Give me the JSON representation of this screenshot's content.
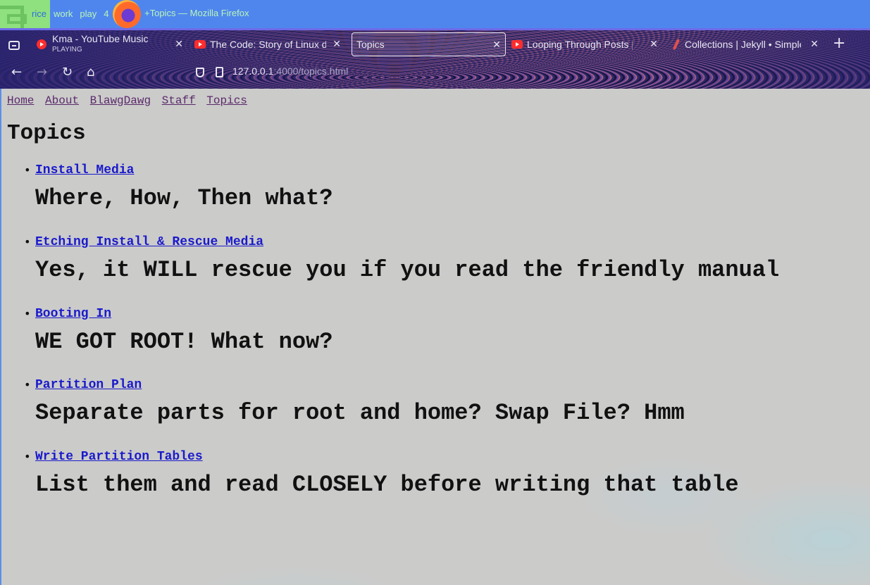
{
  "wm": {
    "workspaces": [
      "rice",
      "work",
      "play",
      "4"
    ],
    "window_title": "+Topics — Mozilla Firefox"
  },
  "tabs": [
    {
      "title": "Kma - YouTube Music",
      "subtitle": "PLAYING",
      "icon": "youtube-music-icon"
    },
    {
      "title": "The Code: Story of Linux documentary",
      "icon": "youtube-icon"
    },
    {
      "title": "Topics",
      "icon": "none",
      "active": true
    },
    {
      "title": "Looping Through Posts | Jekyll",
      "icon": "youtube-icon"
    },
    {
      "title": "Collections | Jekyll • Simple",
      "icon": "jekyll-icon"
    }
  ],
  "urlbar": {
    "host": "127.0.0.1",
    "rest": ":4000/topics.html"
  },
  "site_nav": [
    "Home",
    "About",
    "BlawgDawg",
    "Staff",
    "Topics"
  ],
  "page": {
    "title": "Topics",
    "topics": [
      {
        "link": "Install Media",
        "desc": "Where, How, Then what?"
      },
      {
        "link": "Etching Install & Rescue Media",
        "desc": "Yes, it WILL rescue you if you read the friendly manual"
      },
      {
        "link": "Booting In",
        "desc": "WE GOT ROOT! What now?"
      },
      {
        "link": "Partition Plan",
        "desc": "Separate parts for root and home? Swap File? Hmm"
      },
      {
        "link": "Write Partition Tables",
        "desc": "List them and read CLOSELY before writing that table"
      }
    ]
  },
  "colors": {
    "wm_bar": "#4f86ee",
    "wm_text": "#b9f5b6",
    "link": "#1a1acb",
    "nav_link": "#5a2a6a",
    "page_bg": "#cbcbca"
  }
}
